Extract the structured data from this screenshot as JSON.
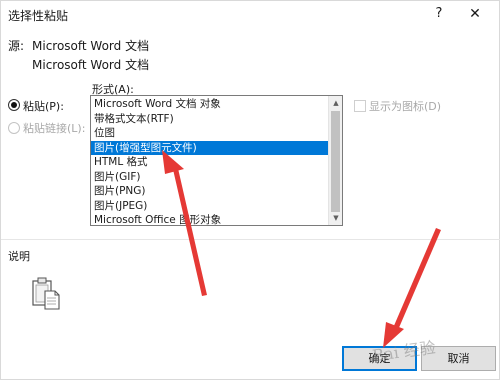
{
  "window": {
    "title": "选择性粘贴",
    "help_glyph": "?",
    "close_glyph": "✕"
  },
  "source": {
    "label": "源:",
    "line1": "Microsoft Word 文档",
    "line2": "Microsoft Word 文档"
  },
  "format": {
    "label": "形式(A):",
    "items": [
      {
        "label": "Microsoft Word 文档 对象",
        "selected": false
      },
      {
        "label": "带格式文本(RTF)",
        "selected": false
      },
      {
        "label": "位图",
        "selected": false
      },
      {
        "label": "图片(增强型图元文件)",
        "selected": true
      },
      {
        "label": "HTML 格式",
        "selected": false
      },
      {
        "label": "图片(GIF)",
        "selected": false
      },
      {
        "label": "图片(PNG)",
        "selected": false
      },
      {
        "label": "图片(JPEG)",
        "selected": false
      },
      {
        "label": "Microsoft Office 图形对象",
        "selected": false
      }
    ]
  },
  "options": {
    "paste_label": "粘贴(P):",
    "paste_link_label": "粘贴链接(L):",
    "paste_selected": true,
    "display_as_icon_label": "显示为图标(D)",
    "display_as_icon_checked": false
  },
  "result": {
    "label": "说明",
    "icon": "clipboard-icon"
  },
  "buttons": {
    "ok_label": "确定",
    "cancel_label": "取消"
  },
  "annotation": {
    "arrow_color": "#e53935",
    "watermark": "Bai 经验"
  },
  "colors": {
    "selection": "#0078d7",
    "ok_border": "#0078d7"
  }
}
